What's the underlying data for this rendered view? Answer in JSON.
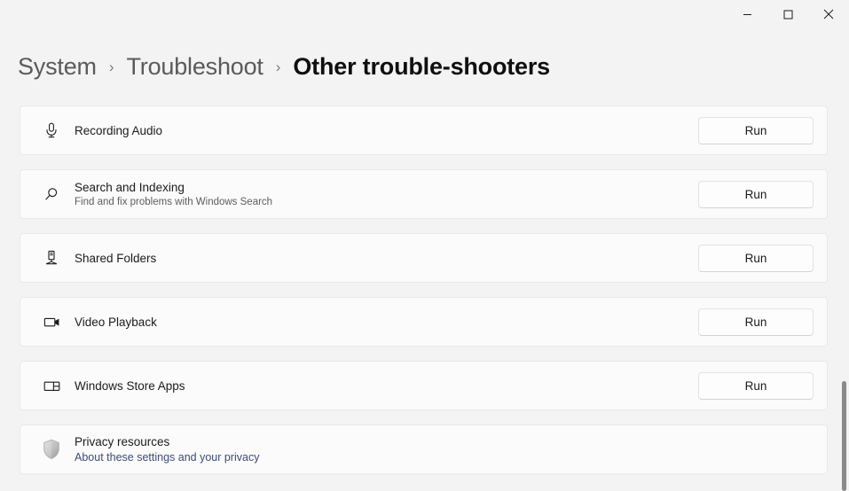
{
  "window": {
    "controls": [
      {
        "name": "minimize",
        "label": "Minimize"
      },
      {
        "name": "maximize",
        "label": "Maximize"
      },
      {
        "name": "close",
        "label": "Close"
      }
    ]
  },
  "breadcrumb": {
    "separator": "›",
    "items": [
      {
        "label": "System",
        "current": false
      },
      {
        "label": "Troubleshoot",
        "current": false
      },
      {
        "label": "Other trouble-shooters",
        "current": true
      }
    ]
  },
  "troubleshooters": [
    {
      "icon": "microphone-icon",
      "title": "Recording Audio",
      "subtitle": "",
      "action": "Run"
    },
    {
      "icon": "search-icon",
      "title": "Search and Indexing",
      "subtitle": "Find and fix problems with Windows Search",
      "action": "Run"
    },
    {
      "icon": "shared-folders-icon",
      "title": "Shared Folders",
      "subtitle": "",
      "action": "Run"
    },
    {
      "icon": "video-camera-icon",
      "title": "Video Playback",
      "subtitle": "",
      "action": "Run"
    },
    {
      "icon": "app-window-icon",
      "title": "Windows Store Apps",
      "subtitle": "",
      "action": "Run"
    }
  ],
  "privacy": {
    "icon": "shield-icon",
    "title": "Privacy resources",
    "link": "About these settings and your privacy"
  },
  "colors": {
    "page_background": "#f3f3f3",
    "card_background": "#fbfbfb",
    "card_border": "#e9e9e9",
    "link": "#3d4b78",
    "text_primary": "#1b1b1b",
    "text_secondary": "#5d5d5d",
    "breadcrumb_inactive": "#5a5a5a",
    "scrollbar_thumb": "#8a8a8a"
  }
}
